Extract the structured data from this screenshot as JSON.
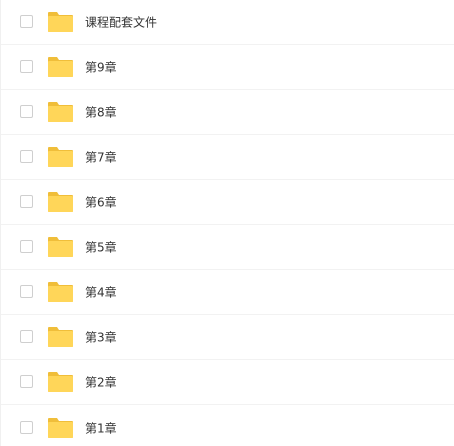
{
  "colors": {
    "folder_body": "#FFD659",
    "folder_tab": "#F0BE3A",
    "text": "#333333",
    "checkbox_border": "#CFCFCF",
    "divider": "#F2F2F2"
  },
  "icons": {
    "checkbox": "checkbox-unchecked",
    "folder": "folder-icon"
  },
  "files": [
    {
      "name": "课程配套文件",
      "type": "folder",
      "checked": false
    },
    {
      "name": "第9章",
      "type": "folder",
      "checked": false
    },
    {
      "name": "第8章",
      "type": "folder",
      "checked": false
    },
    {
      "name": "第7章",
      "type": "folder",
      "checked": false
    },
    {
      "name": "第6章",
      "type": "folder",
      "checked": false
    },
    {
      "name": "第5章",
      "type": "folder",
      "checked": false
    },
    {
      "name": "第4章",
      "type": "folder",
      "checked": false
    },
    {
      "name": "第3章",
      "type": "folder",
      "checked": false
    },
    {
      "name": "第2章",
      "type": "folder",
      "checked": false
    },
    {
      "name": "第1章",
      "type": "folder",
      "checked": false
    }
  ]
}
